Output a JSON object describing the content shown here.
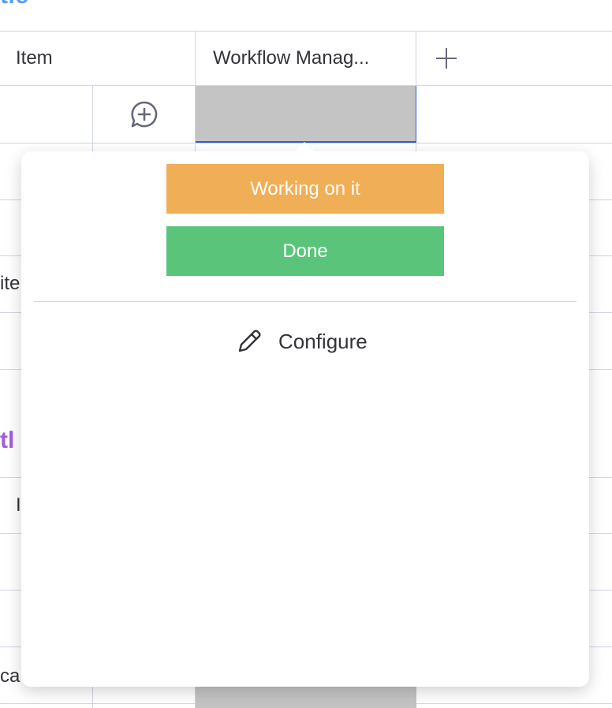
{
  "board": {
    "group_title_top": "tle",
    "group_title_mid": "tl",
    "columns": {
      "item": "Item",
      "status": "Workflow Manag..."
    },
    "partial_row_texts": {
      "row_a": "ite",
      "row_b": "I",
      "row_c": "ca"
    }
  },
  "status_popover": {
    "labels": [
      {
        "text": "Working on it",
        "color": "#f0ae56"
      },
      {
        "text": "Done",
        "color": "#5ac47b"
      }
    ],
    "configure_label": "Configure"
  },
  "icons": {
    "add_column": "plus-icon",
    "add_update": "comment-plus-icon",
    "configure": "pencil-icon"
  }
}
